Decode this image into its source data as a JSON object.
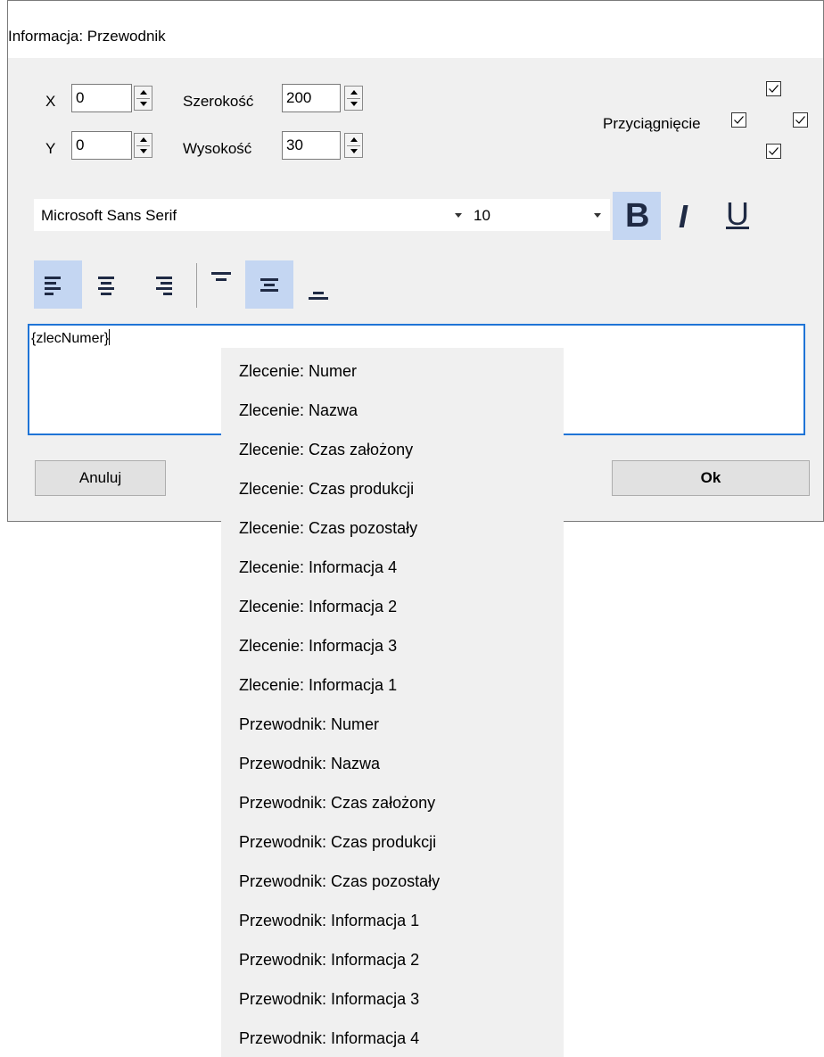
{
  "window": {
    "title": "Informacja: Przewodnik"
  },
  "position": {
    "x_label": "X",
    "x_value": "0",
    "y_label": "Y",
    "y_value": "0",
    "width_label": "Szerokość",
    "width_value": "200",
    "height_label": "Wysokość",
    "height_value": "30"
  },
  "snap": {
    "label": "Przyciągnięcie",
    "top": true,
    "left": true,
    "right": true,
    "bottom": true
  },
  "font": {
    "family": "Microsoft Sans Serif",
    "size": "10",
    "bold_label": "B",
    "italic_label": "I",
    "underline_label": "U",
    "bold": true,
    "italic": false,
    "underline": false
  },
  "alignment": {
    "horizontal": "left",
    "vertical": "middle"
  },
  "editor": {
    "text": "{zlecNumer}"
  },
  "buttons": {
    "cancel": "Anuluj",
    "ok": "Ok"
  },
  "menu": {
    "items": [
      "Zlecenie: Numer",
      "Zlecenie: Nazwa",
      "Zlecenie: Czas założony",
      "Zlecenie: Czas produkcji",
      "Zlecenie: Czas pozostały",
      "Zlecenie: Informacja 4",
      "Zlecenie: Informacja 2",
      "Zlecenie: Informacja 3",
      "Zlecenie: Informacja 1",
      "Przewodnik: Numer",
      "Przewodnik: Nazwa",
      "Przewodnik: Czas założony",
      "Przewodnik: Czas produkcji",
      "Przewodnik: Czas pozostały",
      "Przewodnik: Informacja 1",
      "Przewodnik: Informacja 2",
      "Przewodnik: Informacja 3",
      "Przewodnik: Informacja 4"
    ]
  },
  "colors": {
    "selected_bg": "#c4d6f2",
    "focus_border": "#1f74d6",
    "window_bg": "#f0f0f0",
    "icon_dark": "#1f2a44"
  }
}
